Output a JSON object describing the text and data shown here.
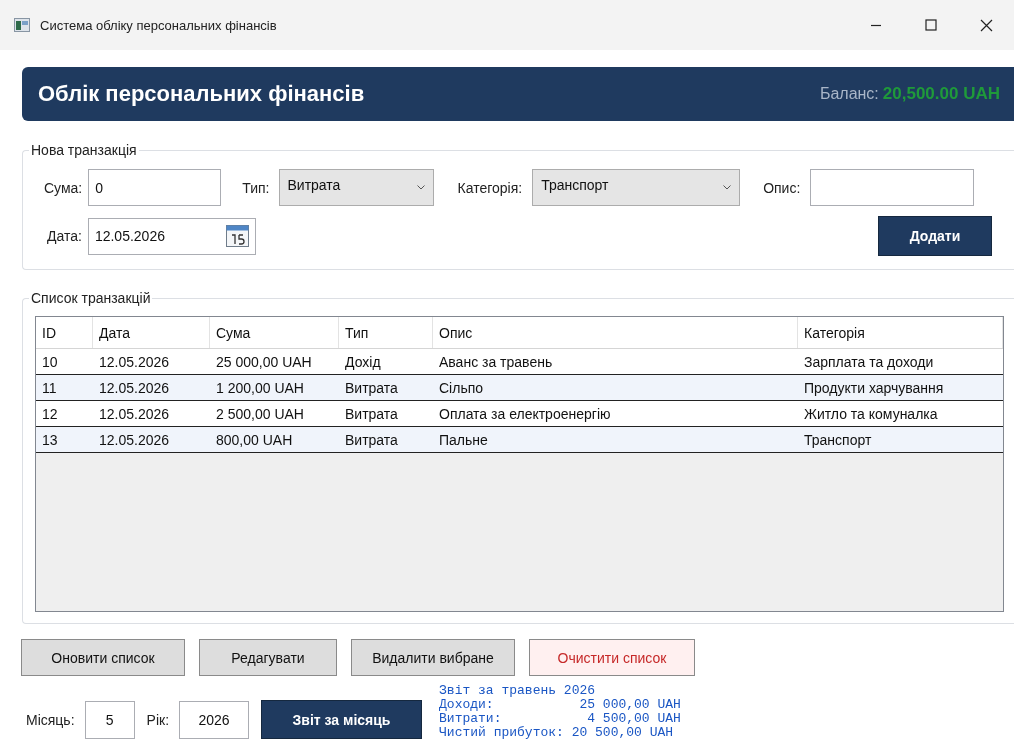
{
  "window": {
    "title": "Система обліку персональних фінансів"
  },
  "header": {
    "title": "Облік персональних фінансів",
    "balance_label": "Баланс:",
    "balance_value": "20,500.00 UAH"
  },
  "new_transaction": {
    "title": "Нова транзакція",
    "amount": {
      "label": "Сума:",
      "value": "0"
    },
    "type": {
      "label": "Тип:",
      "value": "Витрата"
    },
    "category": {
      "label": "Категорія:",
      "value": "Транспорт"
    },
    "description": {
      "label": "Опис:"
    },
    "date": {
      "label": "Дата:",
      "value": "12.05.2026"
    },
    "add_button": "Додати"
  },
  "transactions": {
    "title": "Список транзакцій",
    "columns": [
      "ID",
      "Дата",
      "Сума",
      "Тип",
      "Опис",
      "Категорія"
    ],
    "rows": [
      [
        "10",
        "12.05.2026",
        "25 000,00 UAH",
        "Дохід",
        "Аванс за травень",
        "Зарплата та доходи"
      ],
      [
        "11",
        "12.05.2026",
        "1 200,00 UAH",
        "Витрата",
        "Сільпо",
        "Продукти харчування"
      ],
      [
        "12",
        "12.05.2026",
        "2 500,00 UAH",
        "Витрата",
        "Оплата за електроенергію",
        "Житло та комуналка"
      ],
      [
        "13",
        "12.05.2026",
        "800,00 UAH",
        "Витрата",
        "Пальне",
        "Транспорт"
      ]
    ]
  },
  "actions": [
    {
      "label": "Оновити список",
      "kind": "normal"
    },
    {
      "label": "Редагувати",
      "kind": "normal"
    },
    {
      "label": "Видалити вибране",
      "kind": "normal"
    },
    {
      "label": "Очистити список",
      "kind": "danger"
    }
  ],
  "report": {
    "month_label": "Місяць:",
    "month_value": "5",
    "year_label": "Рік:",
    "year_value": "2026",
    "button": "Звіт за місяць",
    "lines": [
      "Звіт за травень 2026",
      "Доходи:           25 000,00 UAH",
      "Витрати:           4 500,00 UAH",
      "Чистий прибуток: 20 500,00 UAH"
    ]
  }
}
